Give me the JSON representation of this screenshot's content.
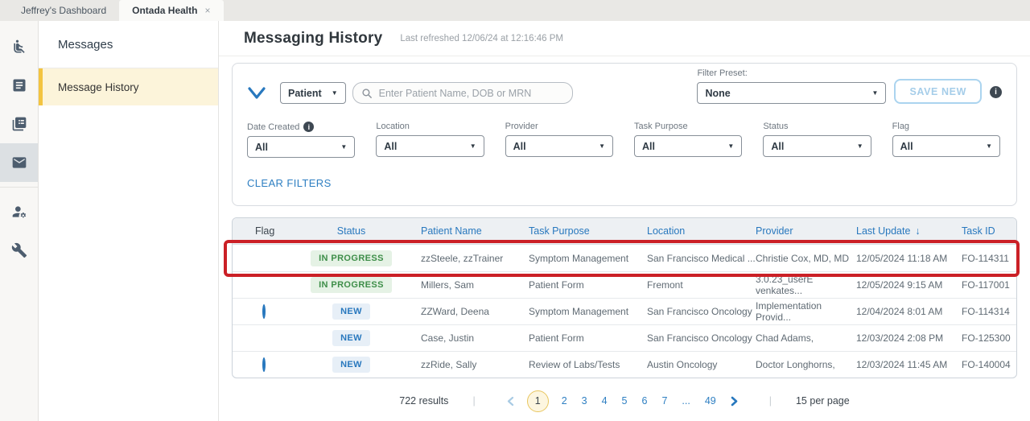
{
  "browser_tabs": {
    "inactive": {
      "label": "Jeffrey's Dashboard"
    },
    "active": {
      "label": "Ontada Health",
      "close": "×"
    }
  },
  "nav_rail": [
    {
      "icon": "patient-chair-icon",
      "selected": false
    },
    {
      "icon": "document-icon",
      "selected": false
    },
    {
      "icon": "forms-stack-icon",
      "selected": false
    },
    {
      "icon": "envelope-icon",
      "selected": true
    },
    {
      "icon": "user-settings-icon",
      "selected": false
    },
    {
      "icon": "wrench-icon",
      "selected": false
    }
  ],
  "sidebar": {
    "title": "Messages",
    "items": [
      {
        "label": "Message History",
        "selected": true
      }
    ]
  },
  "header": {
    "title": "Messaging History",
    "last_refreshed": "Last refreshed 12/06/24 at 12:16:46 PM"
  },
  "filters": {
    "search_category": {
      "value": "Patient"
    },
    "search": {
      "placeholder": "Enter Patient Name, DOB or MRN"
    },
    "preset": {
      "label": "Filter Preset:",
      "value": "None"
    },
    "save_new_label": "SAVE NEW",
    "dropdowns": [
      {
        "label": "Date Created",
        "value": "All",
        "has_info": true
      },
      {
        "label": "Location",
        "value": "All"
      },
      {
        "label": "Provider",
        "value": "All"
      },
      {
        "label": "Task Purpose",
        "value": "All"
      },
      {
        "label": "Status",
        "value": "All"
      },
      {
        "label": "Flag",
        "value": "All"
      }
    ],
    "clear_filters": "CLEAR FILTERS"
  },
  "icons": {
    "caret": "▼",
    "sort_desc": "↓",
    "info": "i"
  },
  "table": {
    "columns": [
      "Flag",
      "Status",
      "Patient Name",
      "Task Purpose",
      "Location",
      "Provider",
      "Last Update",
      "Task ID"
    ],
    "sorted_column": "Last Update",
    "sort_direction": "desc",
    "rows": [
      {
        "flagged": false,
        "status": "IN PROGRESS",
        "patient": "zzSteele, zzTrainer",
        "task_purpose": "Symptom Management",
        "location": "San Francisco Medical ...",
        "provider": "Christie Cox, MD, MD",
        "last_update": "12/05/2024 11:18 AM",
        "task_id": "FO-114311",
        "highlighted": true
      },
      {
        "flagged": false,
        "status": "IN PROGRESS",
        "patient": "Millers, Sam",
        "task_purpose": "Patient Form",
        "location": "Fremont",
        "provider": "3.0.23_userE venkates...",
        "last_update": "12/05/2024 9:15 AM",
        "task_id": "FO-117001",
        "highlighted": false
      },
      {
        "flagged": true,
        "status": "NEW",
        "patient": "ZZWard, Deena",
        "task_purpose": "Symptom Management",
        "location": "San Francisco Oncology",
        "provider": "Implementation Provid...",
        "last_update": "12/04/2024 8:01 AM",
        "task_id": "FO-114314",
        "highlighted": false
      },
      {
        "flagged": false,
        "status": "NEW",
        "patient": "Case, Justin",
        "task_purpose": "Patient Form",
        "location": "San Francisco Oncology",
        "provider": "Chad Adams,",
        "last_update": "12/03/2024 2:08 PM",
        "task_id": "FO-125300",
        "highlighted": false
      },
      {
        "flagged": true,
        "status": "NEW",
        "patient": "zzRide, Sally",
        "task_purpose": "Review of Labs/Tests",
        "location": "Austin Oncology",
        "provider": "Doctor Longhorns,",
        "last_update": "12/03/2024 11:45 AM",
        "task_id": "FO-140004",
        "highlighted": false
      }
    ]
  },
  "pagination": {
    "results": "722 results",
    "separator": "|",
    "current_page": "1",
    "pages": [
      "2",
      "3",
      "4",
      "5",
      "6",
      "7",
      "...",
      "49"
    ],
    "per_page": "15 per page"
  },
  "colors": {
    "accent_blue": "#2878be",
    "link_blue": "#2e7fc2",
    "highlight_red": "#cb2026",
    "selected_yellow_border": "#f3c441",
    "selected_yellow_bg": "#fcf4da",
    "status_green_text": "#3e8e49",
    "status_green_bg": "#e5f2e5",
    "status_blue_text": "#2878be",
    "status_blue_bg": "#e7eff7",
    "pagination_active_bg": "#fdf6e0",
    "pagination_active_border": "#e8c65f"
  }
}
